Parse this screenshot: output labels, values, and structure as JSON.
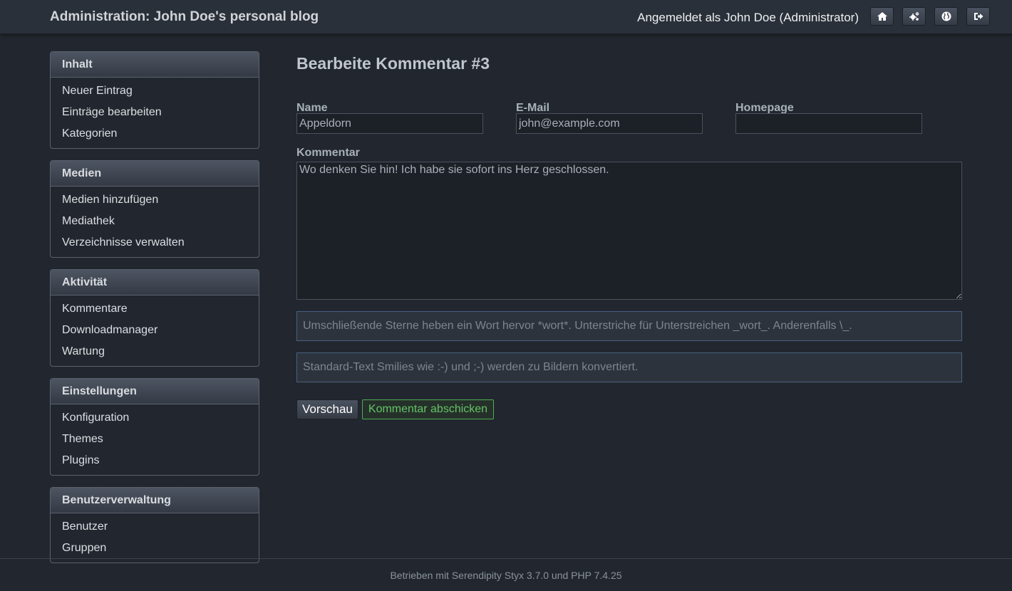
{
  "header": {
    "title": "Administration: John Doe's personal blog",
    "user_status": "Angemeldet als John Doe (Administrator)",
    "icons": [
      "home-icon",
      "settings-icon",
      "globe-icon",
      "logout-icon"
    ]
  },
  "sidebar": {
    "sections": [
      {
        "heading": "Inhalt",
        "items": [
          "Neuer Eintrag",
          "Einträge bearbeiten",
          "Kategorien"
        ]
      },
      {
        "heading": "Medien",
        "items": [
          "Medien hinzufügen",
          "Mediathek",
          "Verzeichnisse verwalten"
        ]
      },
      {
        "heading": "Aktivität",
        "items": [
          "Kommentare",
          "Downloadmanager",
          "Wartung"
        ]
      },
      {
        "heading": "Einstellungen",
        "items": [
          "Konfiguration",
          "Themes",
          "Plugins"
        ]
      },
      {
        "heading": "Benutzerverwaltung",
        "items": [
          "Benutzer",
          "Gruppen"
        ]
      }
    ]
  },
  "main": {
    "heading": "Bearbeite Kommentar #3",
    "fields": {
      "name_label": "Name",
      "name_value": "Appeldorn",
      "email_label": "E-Mail",
      "email_value": "john@example.com",
      "homepage_label": "Homepage",
      "homepage_value": ""
    },
    "comment_label": "Kommentar",
    "comment_value": "Wo denken Sie hin! Ich habe sie sofort ins Herz geschlossen.",
    "hint_markup": "Umschließende Sterne heben ein Wort hervor *wort*. Unterstriche für Unterstreichen _wort_. Anderenfalls \\_.",
    "hint_smilies": "Standard-Text Smilies wie :-) und ;-) werden zu Bildern konvertiert.",
    "preview_button": "Vorschau",
    "submit_button": "Kommentar abschicken"
  },
  "footer": {
    "text": "Betrieben mit Serendipity Styx 3.7.0 und PHP 7.4.25"
  }
}
